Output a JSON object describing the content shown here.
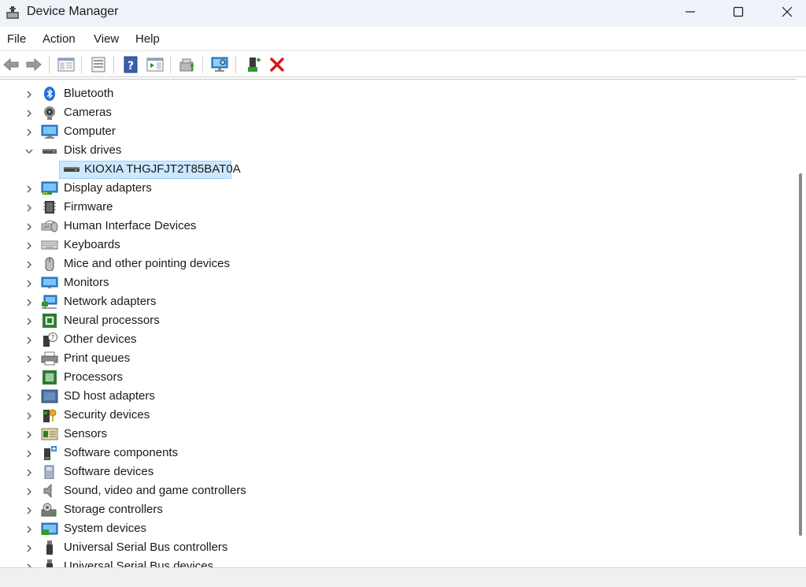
{
  "window": {
    "title": "Device Manager"
  },
  "menu": {
    "items": [
      "File",
      "Action",
      "View",
      "Help"
    ]
  },
  "toolbar": {
    "buttons": [
      "back-icon",
      "forward-icon",
      "show-hide-console-tree-icon",
      "properties-icon",
      "help-icon",
      "action-pane-icon",
      "update-driver-icon",
      "scan-hardware-icon",
      "add-legacy-hardware-icon",
      "uninstall-device-icon"
    ]
  },
  "tree": {
    "categories": [
      {
        "label": "Bluetooth",
        "icon": "bluetooth-icon",
        "expanded": false
      },
      {
        "label": "Cameras",
        "icon": "camera-icon",
        "expanded": false
      },
      {
        "label": "Computer",
        "icon": "computer-icon",
        "expanded": false
      },
      {
        "label": "Disk drives",
        "icon": "disk-drive-icon",
        "expanded": true
      },
      {
        "label": "Display adapters",
        "icon": "display-adapter-icon",
        "expanded": false
      },
      {
        "label": "Firmware",
        "icon": "firmware-icon",
        "expanded": false
      },
      {
        "label": "Human Interface Devices",
        "icon": "hid-icon",
        "expanded": false
      },
      {
        "label": "Keyboards",
        "icon": "keyboard-icon",
        "expanded": false
      },
      {
        "label": "Mice and other pointing devices",
        "icon": "mouse-icon",
        "expanded": false
      },
      {
        "label": "Monitors",
        "icon": "monitor-icon",
        "expanded": false
      },
      {
        "label": "Network adapters",
        "icon": "network-adapter-icon",
        "expanded": false
      },
      {
        "label": "Neural processors",
        "icon": "neural-processor-icon",
        "expanded": false
      },
      {
        "label": "Other devices",
        "icon": "other-devices-icon",
        "expanded": false
      },
      {
        "label": "Print queues",
        "icon": "printer-icon",
        "expanded": false
      },
      {
        "label": "Processors",
        "icon": "processor-icon",
        "expanded": false
      },
      {
        "label": "SD host adapters",
        "icon": "sd-host-adapter-icon",
        "expanded": false
      },
      {
        "label": "Security devices",
        "icon": "security-device-icon",
        "expanded": false
      },
      {
        "label": "Sensors",
        "icon": "sensor-icon",
        "expanded": false
      },
      {
        "label": "Software components",
        "icon": "software-component-icon",
        "expanded": false
      },
      {
        "label": "Software devices",
        "icon": "software-device-icon",
        "expanded": false
      },
      {
        "label": "Sound, video and game controllers",
        "icon": "sound-icon",
        "expanded": false
      },
      {
        "label": "Storage controllers",
        "icon": "storage-controller-icon",
        "expanded": false
      },
      {
        "label": "System devices",
        "icon": "system-device-icon",
        "expanded": false
      },
      {
        "label": "Universal Serial Bus controllers",
        "icon": "usb-controller-icon",
        "expanded": false
      },
      {
        "label": "Universal Serial Bus devices",
        "icon": "usb-device-icon",
        "expanded": false
      }
    ],
    "disk_drive_children": [
      {
        "label": "KIOXIA THGJFJT2T85BAT0A",
        "selected": true
      }
    ]
  },
  "colors": {
    "titlebar_bg": "#eef3fa",
    "selection_bg": "#cce8ff",
    "selection_border": "#99d1ff",
    "uninstall_red": "#d21a1a"
  }
}
